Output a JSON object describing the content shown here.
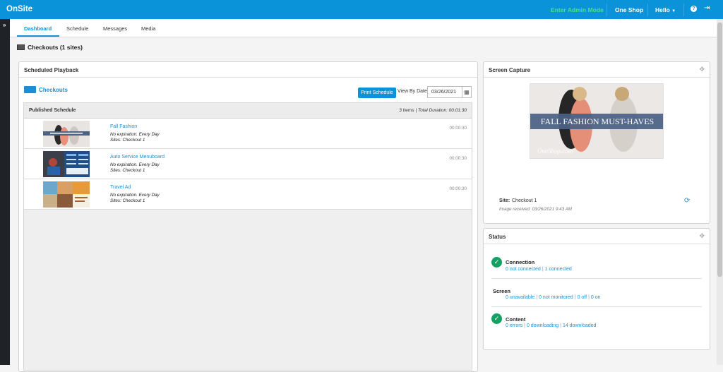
{
  "header": {
    "brand": "OnSite",
    "admin_mode": "Enter Admin Mode",
    "shop": "One Shop",
    "user_menu": "Hello",
    "help_icon": "question-circle-icon",
    "logout_icon": "sign-out-icon"
  },
  "sidebar": {
    "toggle_icon": "chevron-double-right-icon"
  },
  "tabs": [
    {
      "label": "Dashboard",
      "active": true
    },
    {
      "label": "Schedule"
    },
    {
      "label": "Messages"
    },
    {
      "label": "Media"
    }
  ],
  "page_title": "Checkouts (1 sites)",
  "playback": {
    "title": "Scheduled Playback",
    "category": "Checkouts",
    "category_color": "#1a8fd6",
    "print_label": "Print Schedule",
    "view_by_date_label": "View By Date",
    "date_value": "03/26/2021",
    "schedule": {
      "title": "Published Schedule",
      "summary": "3 Items | Total Duration: 00:01:30",
      "rows": [
        {
          "title": "Fall Fashion",
          "expiration": "No expiration. Every Day",
          "sites": "Sites: Checkout 1",
          "duration": "00:00:30"
        },
        {
          "title": "Auto Service Menuboard",
          "expiration": "No expiration. Every Day",
          "sites": "Sites: Checkout 1",
          "duration": "00:00:30"
        },
        {
          "title": "Travel Ad",
          "expiration": "No expiration. Every Day",
          "sites": "Sites: Checkout 1",
          "duration": "00:00:30"
        }
      ]
    }
  },
  "capture": {
    "title": "Screen Capture",
    "image_banner": "FALL FASHION MUST-HAVES",
    "image_brand": "OneShop.com",
    "site_label": "Site:",
    "site_value": "Checkout 1",
    "received": "Image received: 03/26/2021 9:43 AM"
  },
  "status": {
    "title": "Status",
    "connection": {
      "title": "Connection",
      "a": "0 not connected",
      "b": "1 connected"
    },
    "screen": {
      "title": "Screen",
      "a": "0 unavailable",
      "b": "0 not monitored",
      "c": "0 off",
      "d": "0 on"
    },
    "content": {
      "title": "Content",
      "a": "0 errors",
      "b": "0 downloading",
      "c": "14 downloaded"
    }
  },
  "colors": {
    "header": "#0b93d9",
    "accent": "#1a8fd6",
    "admin": "#4ee08a",
    "ok": "#17a063"
  }
}
